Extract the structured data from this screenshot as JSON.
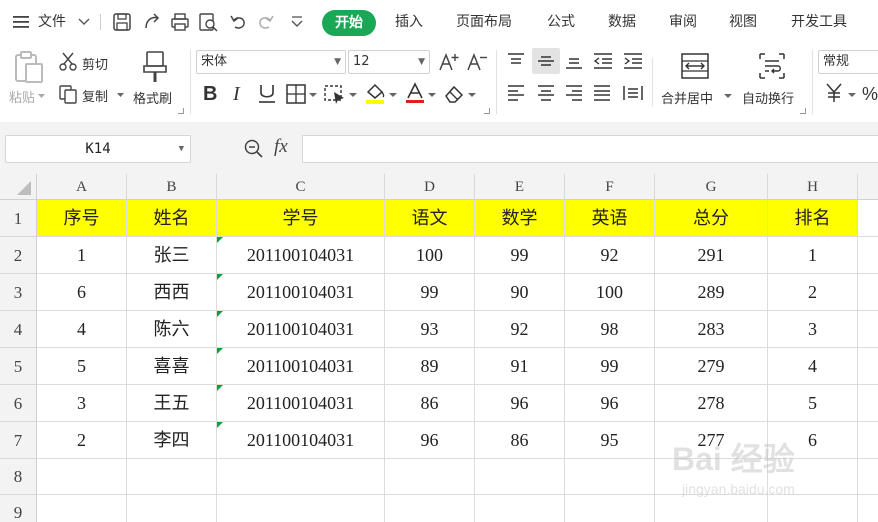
{
  "menu": {
    "file_label": "文件",
    "tabs": [
      "开始",
      "插入",
      "页面布局",
      "公式",
      "数据",
      "审阅",
      "视图",
      "开发工具"
    ]
  },
  "ribbon": {
    "paste_label": "粘贴",
    "cut_label": "剪切",
    "copy_label": "复制",
    "format_painter_label": "格式刷",
    "font_name": "宋体",
    "font_size": "12",
    "merge_center_label": "合并居中",
    "wrap_text_label": "自动换行",
    "number_format": "常规"
  },
  "formula_bar": {
    "name_box": "K14",
    "fx_label": "fx",
    "formula": ""
  },
  "sheet": {
    "columns": [
      "A",
      "B",
      "C",
      "D",
      "E",
      "F",
      "G",
      "H"
    ],
    "row_numbers": [
      "1",
      "2",
      "3",
      "4",
      "5",
      "6",
      "7",
      "8",
      "9"
    ],
    "header": [
      "序号",
      "姓名",
      "学号",
      "语文",
      "数学",
      "英语",
      "总分",
      "排名"
    ],
    "rows": [
      [
        "1",
        "张三",
        "201100104031",
        "100",
        "99",
        "92",
        "291",
        "1"
      ],
      [
        "6",
        "西西",
        "201100104031",
        "99",
        "90",
        "100",
        "289",
        "2"
      ],
      [
        "4",
        "陈六",
        "201100104031",
        "93",
        "92",
        "98",
        "283",
        "3"
      ],
      [
        "5",
        "喜喜",
        "201100104031",
        "89",
        "91",
        "99",
        "279",
        "4"
      ],
      [
        "3",
        "王五",
        "201100104031",
        "86",
        "96",
        "96",
        "278",
        "5"
      ],
      [
        "2",
        "李四",
        "201100104031",
        "96",
        "86",
        "95",
        "277",
        "6"
      ]
    ]
  },
  "watermark": {
    "brand": "Bai 经验",
    "url": "jingyan.baidu.com"
  },
  "colors": {
    "accent": "#1aa856",
    "header_fill": "#ffff00",
    "number_flag": "#1a9b3a"
  }
}
